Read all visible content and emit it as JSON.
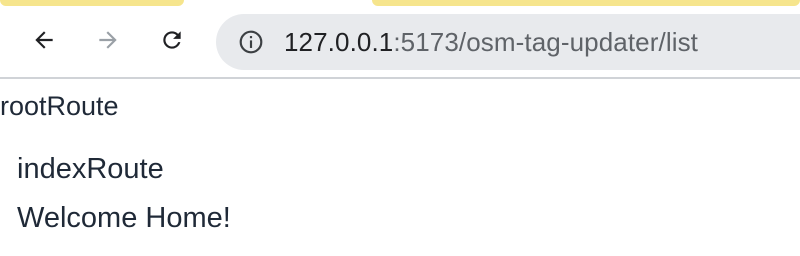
{
  "browser": {
    "address_bar": {
      "url_host": "127.0.0.1",
      "url_rest": ":5173/osm-tag-updater/list"
    },
    "icons": {
      "back": "back-arrow-icon",
      "forward": "forward-arrow-icon",
      "reload": "reload-icon",
      "site_info": "info-icon"
    }
  },
  "page": {
    "root_route_label": "rootRoute",
    "index_route_label": "indexRoute",
    "welcome_text": "Welcome Home!"
  }
}
